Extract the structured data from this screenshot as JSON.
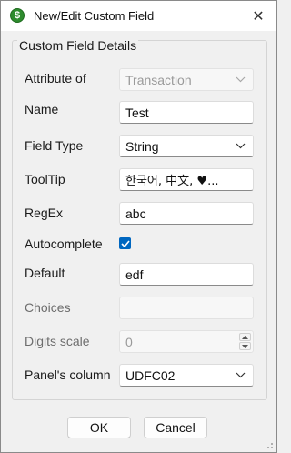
{
  "window": {
    "title": "New/Edit Custom Field",
    "app_icon_glyph": "$",
    "close_glyph": "✕"
  },
  "group": {
    "legend": "Custom Field Details"
  },
  "fields": {
    "attribute_of": {
      "label": "Attribute of",
      "value": "Transaction",
      "enabled": false
    },
    "name": {
      "label": "Name",
      "value": "Test"
    },
    "field_type": {
      "label": "Field Type",
      "value": "String"
    },
    "tooltip": {
      "label": "ToolTip",
      "value": "한국어, 中文, ♥..."
    },
    "regex": {
      "label": "RegEx",
      "value": "abc"
    },
    "autocomplete": {
      "label": "Autocomplete",
      "checked": true
    },
    "default": {
      "label": "Default",
      "value": "edf"
    },
    "choices": {
      "label": "Choices",
      "value": "",
      "enabled": false
    },
    "digits_scale": {
      "label": "Digits scale",
      "value": "0",
      "enabled": false
    },
    "panels_column": {
      "label": "Panel's column",
      "value": "UDFC02"
    }
  },
  "buttons": {
    "ok": "OK",
    "cancel": "Cancel"
  },
  "colors": {
    "accent": "#0067c0",
    "app_icon": "#2e8b2e"
  }
}
